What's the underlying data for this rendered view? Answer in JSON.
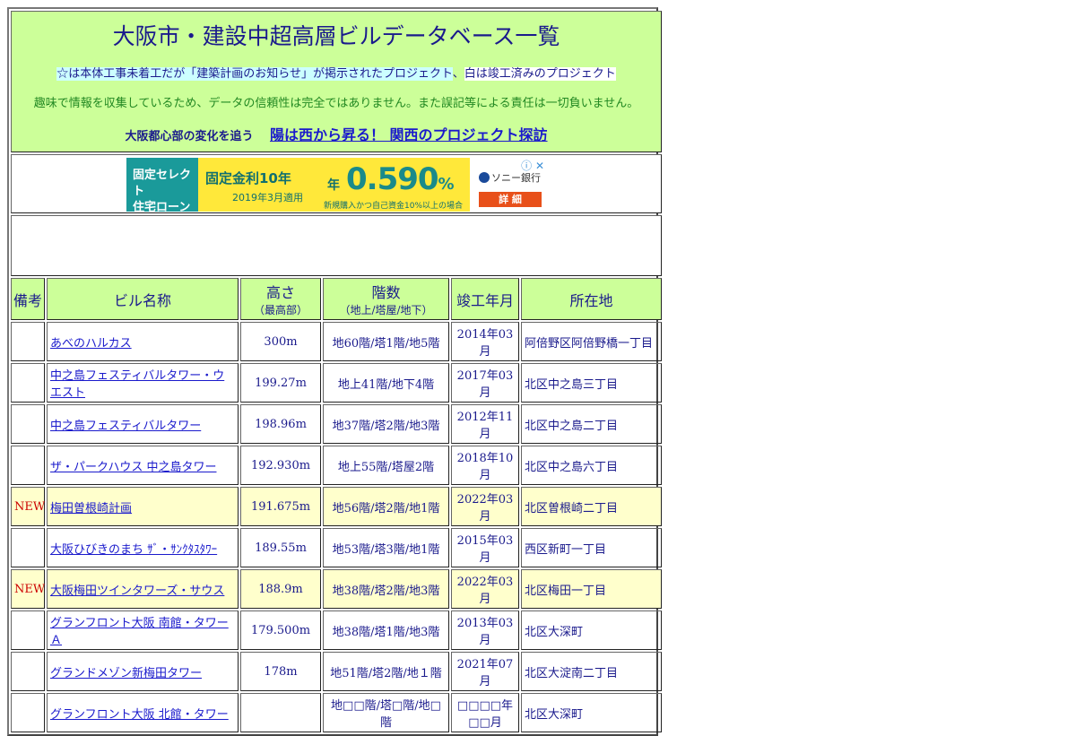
{
  "header": {
    "title": "大阪市・建設中超高層ビルデータベース一覧",
    "legend_star": "☆は本体工事未着工だが「建築計画のお知らせ」が掲示されたプロジェクト",
    "legend_sep": "、",
    "legend_white": "白は竣工済みのプロジェクト",
    "disclaimer": "趣味で情報を収集しているため、データの信頼性は完全ではありません。また誤記等による責任は一切負いません。",
    "sub_label": "大阪都心部の変化を追う",
    "sub_link": "陽は西から昇る！ 関西のプロジェクト探訪"
  },
  "ad": {
    "teal_line1": "固定セレクト",
    "teal_line2": "住宅ローン",
    "rate_label": "固定金利10年",
    "applied": "2019年3月適用",
    "year": "年",
    "rate": "0.590",
    "percent": "%",
    "condition": "新規購入かつ自己資金10%以上の場合",
    "bank": "ソニー銀行",
    "detail": "詳 細",
    "icons": "ⓘ ✕"
  },
  "table": {
    "headers": {
      "note": "備考",
      "name": "ビル名称",
      "height": "高さ",
      "height_sub": "（最高部）",
      "floors": "階数",
      "floors_sub": "（地上/塔屋/地下）",
      "completed": "竣工年月",
      "location": "所在地"
    },
    "rows": [
      {
        "note": "",
        "name": "あべのハルカス",
        "height": "300m",
        "floors": "地60階/塔1階/地5階",
        "completed": "2014年03月",
        "location": "阿倍野区阿倍野橋一丁目"
      },
      {
        "note": "",
        "name": "中之島フェスティバルタワー・ウエスト",
        "height": "199.27m",
        "floors": "地上41階/地下4階",
        "completed": "2017年03月",
        "location": "北区中之島三丁目"
      },
      {
        "note": "",
        "name": "中之島フェスティバルタワー",
        "height": "198.96m",
        "floors": "地37階/塔2階/地3階",
        "completed": "2012年11月",
        "location": "北区中之島二丁目"
      },
      {
        "note": "",
        "name": "ザ・パークハウス 中之島タワー",
        "height": "192.930m",
        "floors": "地上55階/塔屋2階",
        "completed": "2018年10月",
        "location": "北区中之島六丁目"
      },
      {
        "note": "NEW",
        "name": "梅田曽根崎計画",
        "height": "191.675m",
        "floors": "地56階/塔2階/地1階",
        "completed": "2022年03月",
        "location": "北区曽根崎二丁目"
      },
      {
        "note": "",
        "name": "大阪ひびきのまち ｻﾞ・ｻﾝｸﾀｽﾀﾜｰ",
        "height": "189.55m",
        "floors": "地53階/塔3階/地1階",
        "completed": "2015年03月",
        "location": "西区新町一丁目"
      },
      {
        "note": "NEW",
        "name": "大阪梅田ツインタワーズ・サウス",
        "height": "188.9m",
        "floors": "地38階/塔2階/地3階",
        "completed": "2022年03月",
        "location": "北区梅田一丁目"
      },
      {
        "note": "",
        "name": "グランフロント大阪 南館・タワーＡ",
        "height": "179.500m",
        "floors": "地38階/塔1階/地3階",
        "completed": "2013年03月",
        "location": "北区大深町"
      },
      {
        "note": "",
        "name": "グランドメゾン新梅田タワー",
        "height": "178m",
        "floors": "地51階/塔2階/地１階",
        "completed": "2021年07月",
        "location": "北区大淀南二丁目"
      },
      {
        "note": "",
        "name": "グランフロント大阪 北館・タワー",
        "height": "",
        "floors": "地□□階/塔□階/地□階",
        "completed": "□□□□年□□月",
        "location": "北区大深町"
      }
    ]
  }
}
